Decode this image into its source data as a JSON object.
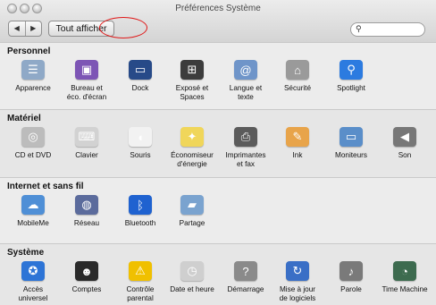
{
  "window": {
    "title": "Préférences Système"
  },
  "toolbar": {
    "back_glyph": "◀",
    "forward_glyph": "▶",
    "show_all_label": "Tout afficher",
    "search_placeholder": ""
  },
  "sections": [
    {
      "title": "Personnel",
      "items": [
        {
          "label": "Apparence",
          "icon": "apparence-icon",
          "color": "#8fa9c7"
        },
        {
          "label": "Bureau et\néco. d'écran",
          "icon": "desktop-screensaver-icon",
          "color": "#7d55b5"
        },
        {
          "label": "Dock",
          "icon": "dock-icon",
          "color": "#274a88"
        },
        {
          "label": "Exposé et\nSpaces",
          "icon": "expose-spaces-icon",
          "color": "#3c3c3c"
        },
        {
          "label": "Langue et\ntexte",
          "icon": "language-text-icon",
          "color": "#6f95c9"
        },
        {
          "label": "Sécurité",
          "icon": "security-house-icon",
          "color": "#9a9a9a"
        },
        {
          "label": "Spotlight",
          "icon": "spotlight-icon",
          "color": "#2c7be0"
        }
      ]
    },
    {
      "title": "Matériel",
      "items": [
        {
          "label": "CD et DVD",
          "icon": "cd-dvd-icon",
          "color": "#bcbcbc"
        },
        {
          "label": "Clavier",
          "icon": "keyboard-icon",
          "color": "#d2d2d2"
        },
        {
          "label": "Souris",
          "icon": "mouse-icon",
          "color": "#f2f2f2"
        },
        {
          "label": "Économiseur\nd'énergie",
          "icon": "energy-saver-icon",
          "color": "#f0d65a"
        },
        {
          "label": "Imprimantes\net fax",
          "icon": "printer-icon",
          "color": "#5b5b5b"
        },
        {
          "label": "Ink",
          "icon": "ink-icon",
          "color": "#e8a44a"
        },
        {
          "label": "Moniteurs",
          "icon": "displays-icon",
          "color": "#5a8ec9"
        },
        {
          "label": "Son",
          "icon": "sound-icon",
          "color": "#777777"
        }
      ]
    },
    {
      "title": "Internet et sans fil",
      "items": [
        {
          "label": "MobileMe",
          "icon": "mobileme-cloud-icon",
          "color": "#4f8fd6"
        },
        {
          "label": "Réseau",
          "icon": "network-globe-icon",
          "color": "#5b6b9c"
        },
        {
          "label": "Bluetooth",
          "icon": "bluetooth-icon",
          "color": "#1f62d0"
        },
        {
          "label": "Partage",
          "icon": "sharing-folder-icon",
          "color": "#7aa3cf"
        }
      ]
    },
    {
      "title": "Système",
      "items": [
        {
          "label": "Accès\nuniversel",
          "icon": "universal-access-icon",
          "color": "#2d74d6"
        },
        {
          "label": "Comptes",
          "icon": "accounts-icon",
          "color": "#2a2a2a"
        },
        {
          "label": "Contrôle\nparental",
          "icon": "parental-controls-icon",
          "color": "#f0c000"
        },
        {
          "label": "Date et heure",
          "icon": "date-time-icon",
          "color": "#cfcfcf"
        },
        {
          "label": "Démarrage",
          "icon": "startup-disk-icon",
          "color": "#8a8a8a"
        },
        {
          "label": "Mise à jour\nde logiciels",
          "icon": "software-update-icon",
          "color": "#3a6fc6"
        },
        {
          "label": "Parole",
          "icon": "speech-icon",
          "color": "#7a7a7a"
        },
        {
          "label": "Time Machine",
          "icon": "time-machine-icon",
          "color": "#3d6b4f"
        }
      ]
    }
  ]
}
